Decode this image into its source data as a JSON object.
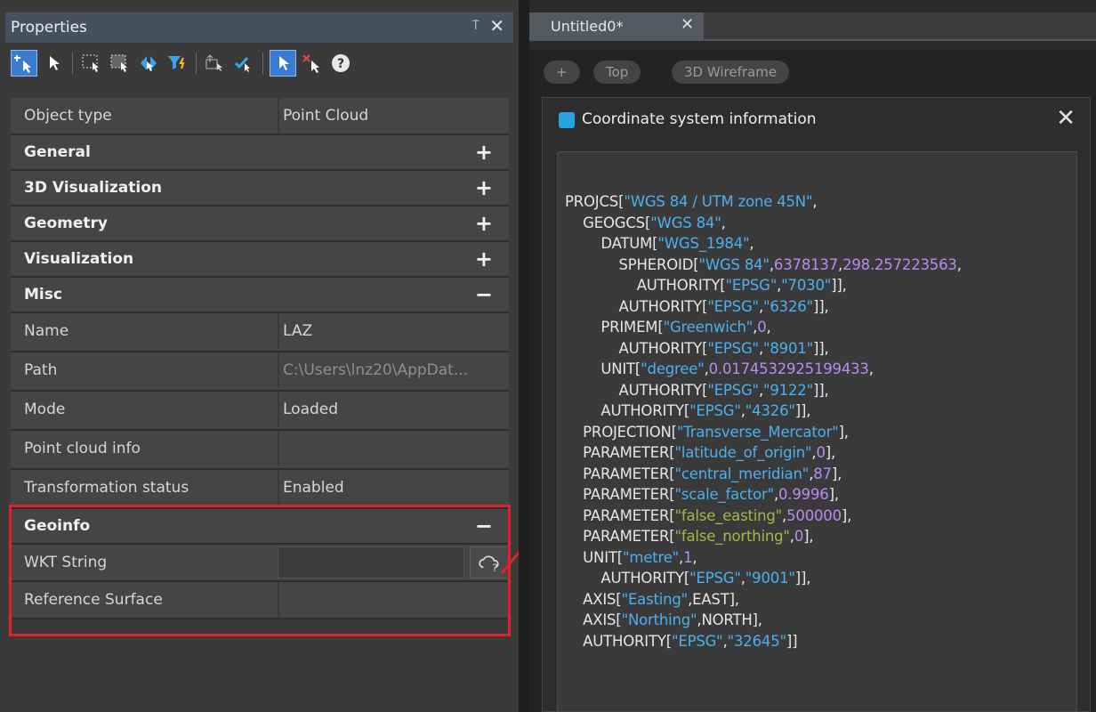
{
  "properties_panel": {
    "title": "Properties",
    "pin_glyph": "⍑",
    "close_glyph": "✕",
    "toolbar_icons": [
      "add-selection-icon",
      "select-arrow-icon",
      "window-select-icon",
      "crossing-select-icon",
      "select-similar-icon",
      "quick-filter-icon",
      "select-by-layer-icon",
      "deselect-icon",
      "toggle-pickadd-icon",
      "clear-selection-icon",
      "help-icon"
    ],
    "rows": [
      {
        "key": "Object type",
        "value": "Point Cloud"
      }
    ],
    "sections": {
      "general": "General",
      "vis3d": "3D Visualization",
      "geometry": "Geometry",
      "visualization": "Visualization",
      "misc": "Misc",
      "geoinfo": "Geoinfo"
    },
    "misc_rows": [
      {
        "key": "Name",
        "value": "LAZ"
      },
      {
        "key": "Path",
        "value": "C:\\Users\\lnz20\\AppDat..."
      },
      {
        "key": "Mode",
        "value": "Loaded"
      },
      {
        "key": "Point cloud info",
        "value": ""
      },
      {
        "key": "Transformation status",
        "value": "Enabled"
      }
    ],
    "geoinfo_rows": [
      {
        "key": "WKT String",
        "value": ""
      },
      {
        "key": "Reference Surface",
        "value": ""
      }
    ],
    "plus": "+",
    "minus": "−"
  },
  "document": {
    "tab_label": "Untitled0*",
    "tab_close": "✕",
    "viewport_buttons": [
      "+",
      "Top",
      "3D Wireframe"
    ]
  },
  "dialog": {
    "title": "Coordinate system information",
    "close": "✕",
    "highlight_color": "#e0202a",
    "string_color": "#4db0ee",
    "number_color": "#b98cf0",
    "accent_string_color": "#a3b84a",
    "wkt_lines": [
      "PROJCS[\"WGS 84 / UTM zone 45N\",",
      "    GEOGCS[\"WGS 84\",",
      "        DATUM[\"WGS_1984\",",
      "            SPHEROID[\"WGS 84\",6378137,298.257223563,",
      "                AUTHORITY[\"EPSG\",\"7030\"]],",
      "            AUTHORITY[\"EPSG\",\"6326\"]],",
      "        PRIMEM[\"Greenwich\",0,",
      "            AUTHORITY[\"EPSG\",\"8901\"]],",
      "        UNIT[\"degree\",0.0174532925199433,",
      "            AUTHORITY[\"EPSG\",\"9122\"]],",
      "        AUTHORITY[\"EPSG\",\"4326\"]],",
      "    PROJECTION[\"Transverse_Mercator\"],",
      "    PARAMETER[\"latitude_of_origin\",0],",
      "    PARAMETER[\"central_meridian\",87],",
      "    PARAMETER[\"scale_factor\",0.9996],",
      "    PARAMETER[\"false_easting\",500000],",
      "    PARAMETER[\"false_northing\",0],",
      "    UNIT[\"metre\",1,",
      "        AUTHORITY[\"EPSG\",\"9001\"]],",
      "    AXIS[\"Easting\",EAST],",
      "    AXIS[\"Northing\",NORTH],",
      "    AUTHORITY[\"EPSG\",\"32645\"]]"
    ]
  }
}
